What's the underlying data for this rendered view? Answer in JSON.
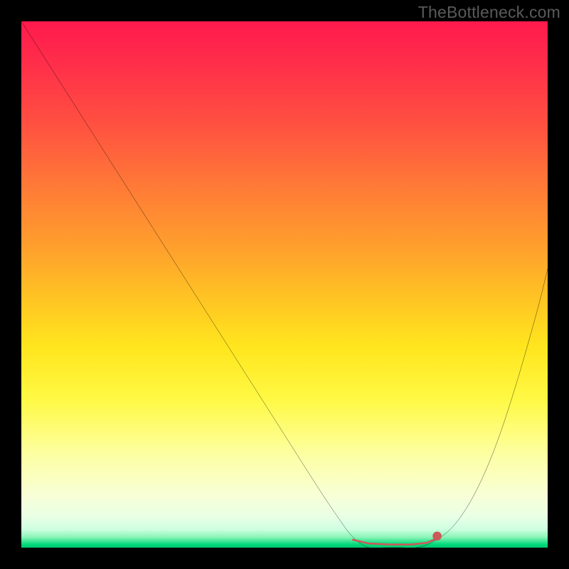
{
  "watermark": "TheBottleneck.com",
  "chart_data": {
    "type": "line",
    "title": "",
    "xlabel": "",
    "ylabel": "",
    "xlim": [
      0,
      100
    ],
    "ylim": [
      0,
      100
    ],
    "background_gradient": {
      "orientation": "vertical",
      "stops": [
        {
          "pos": 0,
          "color": "#ff1a4d"
        },
        {
          "pos": 0.2,
          "color": "#ff5240"
        },
        {
          "pos": 0.44,
          "color": "#ffa32c"
        },
        {
          "pos": 0.62,
          "color": "#ffe61e"
        },
        {
          "pos": 0.82,
          "color": "#fdffa0"
        },
        {
          "pos": 0.94,
          "color": "#e9ffe5"
        },
        {
          "pos": 0.99,
          "color": "#00d97a"
        },
        {
          "pos": 1.0,
          "color": "#00c46e"
        }
      ]
    },
    "series": [
      {
        "name": "bottleneck-curve",
        "color": "#000000",
        "x": [
          0,
          7,
          14,
          21,
          28,
          35,
          42,
          49,
          56,
          60,
          63,
          66,
          69,
          72,
          75,
          78,
          82,
          86,
          90,
          94,
          98,
          100
        ],
        "y": [
          100,
          89,
          78,
          67,
          56,
          45,
          34,
          23,
          12,
          6,
          2,
          0,
          0,
          0,
          0,
          1,
          4,
          10,
          19,
          31,
          45,
          53
        ]
      }
    ],
    "markers": [
      {
        "name": "optimal-range",
        "color": "#cc5a5a",
        "type": "thick-band",
        "points": [
          {
            "x": 63,
            "y": 1.5
          },
          {
            "x": 66,
            "y": 0.8
          },
          {
            "x": 70,
            "y": 0.6
          },
          {
            "x": 74,
            "y": 0.6
          },
          {
            "x": 77,
            "y": 0.9
          },
          {
            "x": 79,
            "y": 1.8
          }
        ]
      },
      {
        "name": "optimal-dot",
        "color": "#cc5a5a",
        "type": "dot",
        "x": 79,
        "y": 2.2
      }
    ]
  }
}
